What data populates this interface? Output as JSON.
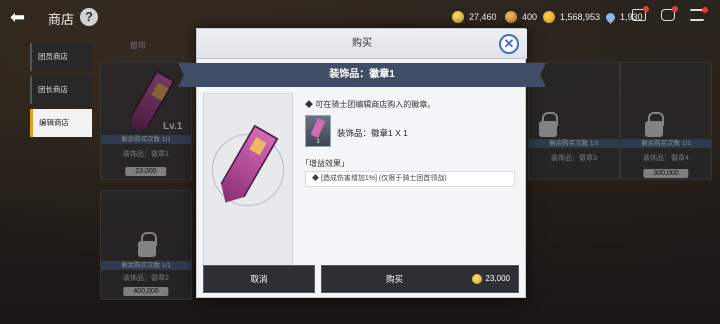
{
  "header": {
    "title": "商店",
    "help": "?"
  },
  "resources": [
    {
      "icon": "coin-icon",
      "value": "27,460"
    },
    {
      "icon": "medal-icon",
      "value": "400"
    },
    {
      "icon": "gold-icon",
      "value": "1,568,953"
    },
    {
      "icon": "drop-icon",
      "value": "1,930"
    }
  ],
  "sidebar": {
    "items": [
      {
        "label": "团员商店",
        "active": false
      },
      {
        "label": "团长商店",
        "active": false
      },
      {
        "label": "编辑商店",
        "active": true
      }
    ]
  },
  "background_cards": [
    {
      "name": "装饰品：徽章1",
      "remaining": "剩余购买次数 1/1",
      "price": "23,000",
      "level": "Lv.1",
      "locked": false
    },
    {
      "name": "装饰品：徽章2",
      "remaining": "剩余购买次数 1/1",
      "price": "400,000",
      "locked": true
    },
    {
      "name": "装饰品：徽章3",
      "remaining": "剩余购买次数 1/1",
      "price": "",
      "locked": true
    },
    {
      "name": "装饰品：徽章4",
      "remaining": "剩余购买次数 1/1",
      "price": "300,000",
      "locked": true
    }
  ],
  "background_tab": "窗帘",
  "modal": {
    "title": "购买",
    "subtitle": "装饰品：徽章1",
    "description": "◆ 可在骑士团编辑商店购入的徽章。",
    "item_line": "装饰品：徽章1 X 1",
    "item_qty": "1",
    "effect_title": "「增益效果」",
    "effect_text": "◆ [造成伤害增加1%] (仅限于骑士团首领战)",
    "cancel_label": "取消",
    "buy_label": "购买",
    "buy_cost": "23,000"
  },
  "colors": {
    "accent": "#3d6fc2",
    "band": "#3f4e66",
    "badge": "#d46ab4"
  }
}
